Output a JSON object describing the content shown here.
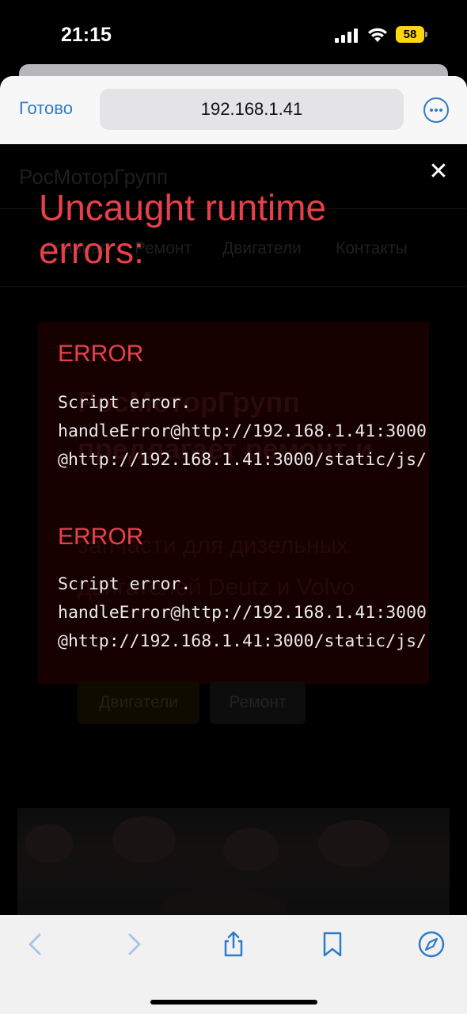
{
  "status_bar": {
    "time": "21:15",
    "battery_level": "58",
    "battery_color": "#ffd60a"
  },
  "browser": {
    "done_label": "Готово",
    "url": "192.168.1.41",
    "accent_color": "#2f7cc6"
  },
  "site": {
    "logo": "РосМоторГрупп",
    "nav": [
      "Главная",
      "Ремонт",
      "Двигатели",
      "Контакты"
    ],
    "hero_title": "РосМоторГрупп предлагает ремонт и",
    "hero_subtitle": "запчасти для дизельных двигателей Deutz и Volvo",
    "btn_engines": "Двигатели",
    "btn_repair": "Ремонт"
  },
  "overlay": {
    "title": "Uncaught runtime errors:",
    "accent_color": "#e8404a",
    "errors": [
      {
        "label": "ERROR",
        "lines": [
          "Script error.",
          "handleError@http://192.168.1.41:3000",
          "@http://192.168.1.41:3000/static/js/"
        ]
      },
      {
        "label": "ERROR",
        "lines": [
          "Script error.",
          "handleError@http://192.168.1.41:3000",
          "@http://192.168.1.41:3000/static/js/"
        ]
      }
    ]
  },
  "toolbar": {
    "icons": [
      "back-icon",
      "forward-icon",
      "share-icon",
      "bookmarks-icon",
      "compass-icon"
    ]
  }
}
